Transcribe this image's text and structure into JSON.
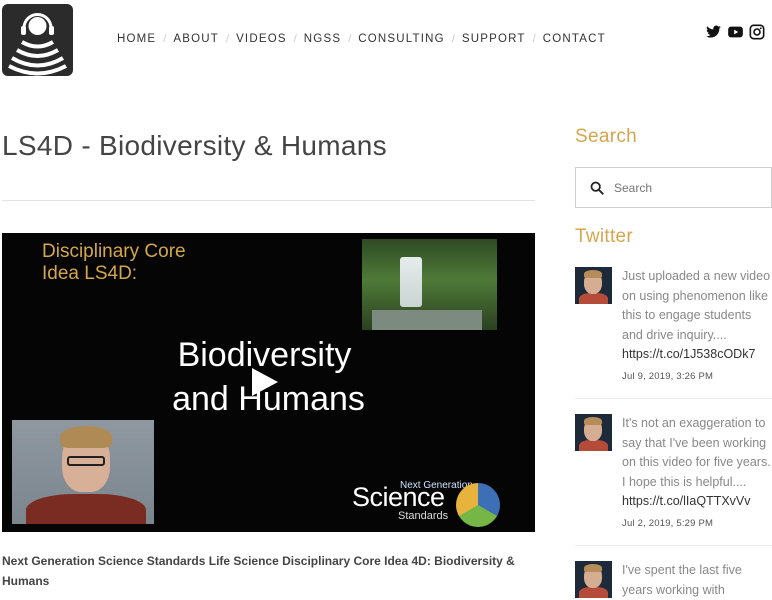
{
  "nav": {
    "items": [
      "HOME",
      "ABOUT",
      "VIDEOS",
      "NGSS",
      "CONSULTING",
      "SUPPORT",
      "CONTACT"
    ],
    "separator": "/"
  },
  "social": [
    "twitter-icon",
    "youtube-icon",
    "instagram-icon"
  ],
  "main": {
    "title": "LS4D - Biodiversity & Humans",
    "video": {
      "dci_line1": "Disciplinary Core",
      "dci_line2": "Idea LS4D:",
      "main_line1": "Biodiversity",
      "main_line2": "and Humans",
      "ngss_top": "Next Generation",
      "ngss_science": "Science",
      "ngss_standards": "Standards"
    },
    "caption": "Next Generation Science Standards Life Science Disciplinary Core Idea 4D:  Biodiversity & Humans"
  },
  "sidebar": {
    "search_heading": "Search",
    "search_placeholder": "Search",
    "twitter_heading": "Twitter",
    "tweets": [
      {
        "text": "Just uploaded a new video on using phenomenon like this to engage students and drive inquiry....",
        "link": "https://t.co/1J538cODk7",
        "date": "Jul 9, 2019, 3:26 PM"
      },
      {
        "text": "It's not an exaggeration to say that I've been working on this video for five years. I hope this is helpful....",
        "link": "https://t.co/lIaQTTXvVv",
        "date": "Jul 2, 2019, 5:29 PM"
      },
      {
        "text": "I've spent the last five years working with",
        "link": "",
        "date": ""
      }
    ]
  },
  "colors": {
    "accent": "#d4a64d",
    "logo_bg": "#2b2b2b"
  }
}
